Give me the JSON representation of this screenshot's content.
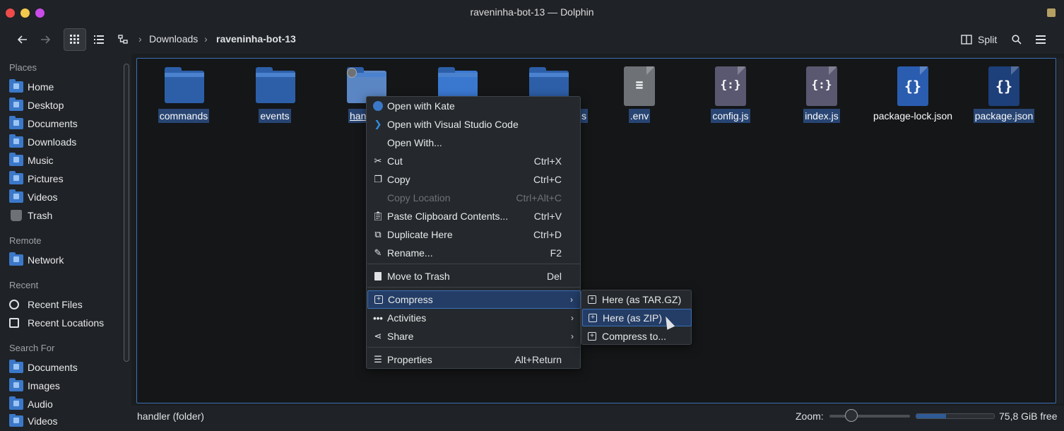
{
  "window": {
    "title": "raveninha-bot-13 — Dolphin"
  },
  "toolbar": {
    "split_label": "Split",
    "breadcrumb": [
      "Downloads",
      "raveninha-bot-13"
    ]
  },
  "sidebar": {
    "places_title": "Places",
    "places": [
      "Home",
      "Desktop",
      "Documents",
      "Downloads",
      "Music",
      "Pictures",
      "Videos",
      "Trash"
    ],
    "remote_title": "Remote",
    "remote": [
      "Network"
    ],
    "recent_title": "Recent",
    "recent": [
      "Recent Files",
      "Recent Locations"
    ],
    "search_title": "Search For",
    "search": [
      "Documents",
      "Images",
      "Audio",
      "Videos"
    ]
  },
  "files": [
    {
      "name": "commands",
      "kind": "folder"
    },
    {
      "name": "events",
      "kind": "folder"
    },
    {
      "name": "handler",
      "visible_text": "han",
      "kind": "folder"
    },
    {
      "name": "",
      "kind": "folder"
    },
    {
      "name": "s",
      "kind": "folder"
    },
    {
      "name": ".env",
      "kind": "text"
    },
    {
      "name": "config.js",
      "kind": "js"
    },
    {
      "name": "index.js",
      "kind": "js"
    },
    {
      "name": "package-lock.json",
      "kind": "json"
    },
    {
      "name": "package.json",
      "kind": "json"
    }
  ],
  "context_menu": {
    "items": [
      {
        "label": "Open with Kate",
        "shortcut": "",
        "icon": "kate-icon"
      },
      {
        "label": "Open with Visual Studio Code",
        "shortcut": "",
        "icon": "vscode-icon"
      },
      {
        "label": "Open With...",
        "shortcut": "",
        "icon": ""
      },
      {
        "label": "Cut",
        "shortcut": "Ctrl+X",
        "icon": "scissors-icon"
      },
      {
        "label": "Copy",
        "shortcut": "Ctrl+C",
        "icon": "copy-icon"
      },
      {
        "label": "Copy Location",
        "shortcut": "Ctrl+Alt+C",
        "icon": "",
        "disabled": true
      },
      {
        "label": "Paste Clipboard Contents...",
        "shortcut": "Ctrl+V",
        "icon": "paste-icon"
      },
      {
        "label": "Duplicate Here",
        "shortcut": "Ctrl+D",
        "icon": "duplicate-icon"
      },
      {
        "label": "Rename...",
        "shortcut": "F2",
        "icon": "pencil-icon"
      },
      {
        "label": "Move to Trash",
        "shortcut": "Del",
        "icon": "trash-icon"
      },
      {
        "label": "Compress",
        "shortcut": "",
        "icon": "compress-icon",
        "submenu": true
      },
      {
        "label": "Activities",
        "shortcut": "",
        "icon": "activities-icon",
        "submenu": true
      },
      {
        "label": "Share",
        "shortcut": "",
        "icon": "share-icon",
        "submenu": true
      },
      {
        "label": "Properties",
        "shortcut": "Alt+Return",
        "icon": "properties-icon"
      }
    ]
  },
  "compress_submenu": {
    "items": [
      "Here (as TAR.GZ)",
      "Here (as ZIP)",
      "Compress to..."
    ]
  },
  "statusbar": {
    "selection": "handler (folder)",
    "zoom_label": "Zoom:",
    "zoom_level": 0.2,
    "free_space": "75,8 GiB free",
    "used_fraction": 0.38
  },
  "colors": {
    "accent": "#3b6fb6",
    "folder": "#2d5fa8",
    "selection": "#284573"
  }
}
